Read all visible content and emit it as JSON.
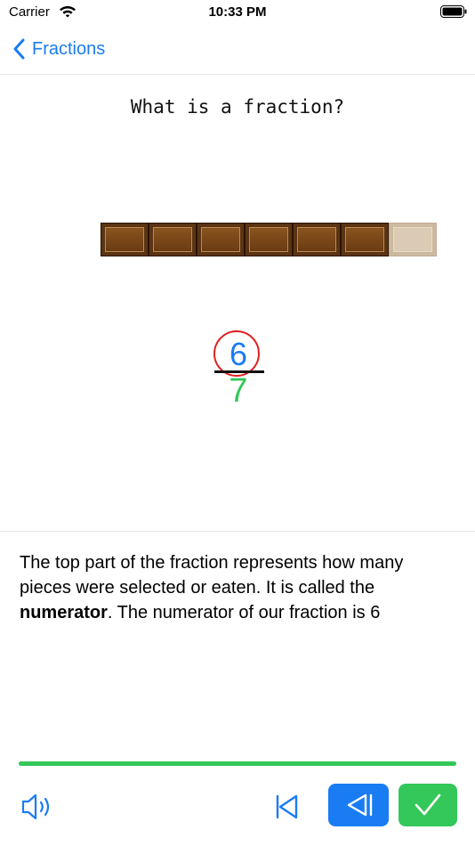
{
  "status_bar": {
    "carrier": "Carrier",
    "time": "10:33 PM"
  },
  "nav": {
    "back_label": "Fractions"
  },
  "lesson": {
    "title": "What is a fraction?",
    "bar": {
      "total_pieces": 7,
      "eaten_pieces": 6
    },
    "fraction": {
      "numerator": "6",
      "denominator": "7"
    }
  },
  "explanation": {
    "part1": "The top part of the fraction represents how many pieces were selected or eaten. It is called the ",
    "term": "numerator",
    "part2": ". The numerator of our fraction is 6"
  },
  "progress": {
    "fraction_complete": 1.0
  },
  "colors": {
    "accent_blue": "#1a7cf2",
    "accent_green": "#34c759",
    "numerator_circle": "#e02020"
  },
  "icons": [
    "wifi-icon",
    "battery-icon",
    "chevron-left-icon",
    "speaker-icon",
    "skip-back-icon",
    "step-back-icon",
    "checkmark-icon"
  ]
}
